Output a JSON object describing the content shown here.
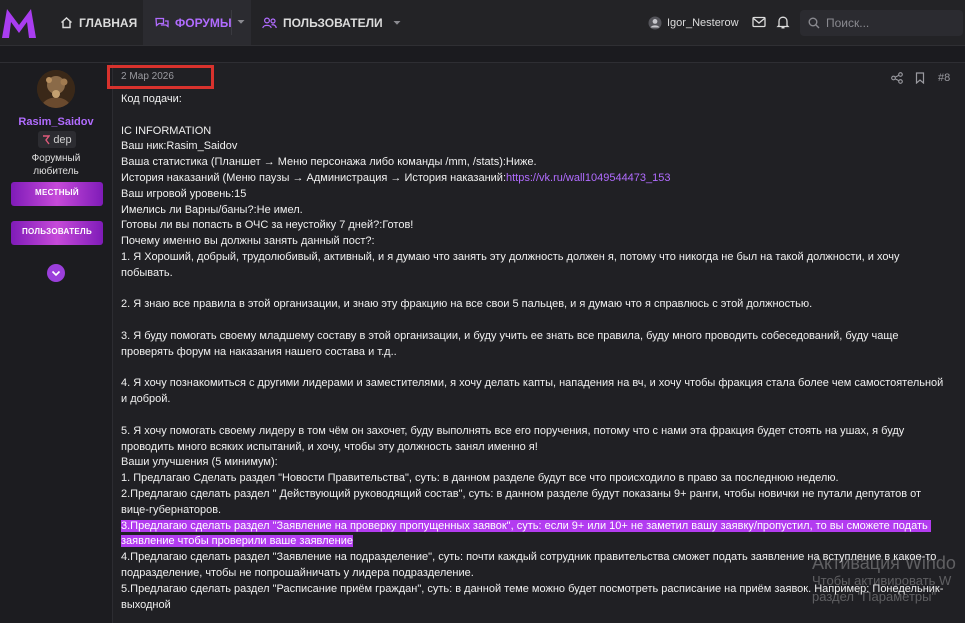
{
  "nav": {
    "home": "ГЛАВНАЯ",
    "forums": "ФОРУМЫ",
    "users": "ПОЛЬЗОВАТЕЛИ",
    "username": "Igor_Nesterow",
    "search_placeholder": "Поиск..."
  },
  "author": {
    "name": "Rasim_Saidov",
    "badge": "dep",
    "title_line1": "Форумный",
    "title_line2": "любитель",
    "banner1": "МЕСТНЫЙ",
    "banner2": "ПОЛЬЗОВАТЕЛЬ"
  },
  "post": {
    "date": "2 Мар 2026",
    "number": "#8",
    "link": "https://vk.ru/wall1049544473_153",
    "lines": [
      "Код подачи:",
      "",
      "IC INFORMATION",
      "Ваш ник:Rasim_Saidov",
      "Ваша статистика (Планшет → Меню персонажа либо команды /mm, /stats):Ниже.",
      "История наказаний (Меню паузы → Администрация → История наказаний:",
      "Ваш игровой уровень:15",
      "Имелись ли Варны/баны?:Не имел.",
      "Готовы ли вы попасть в ОЧС за неустойку 7 дней?:Готов!",
      "Почему именно вы должны занять данный пост?:",
      "1. Я Хороший, добрый, трудолюбивый, активный, и я думаю что занять эту должность должен я, потому что никогда не был на такой должности, и хочу побывать.",
      "",
      "2. Я знаю все правила в этой организации, и знаю эту фракцию на все свои 5 пальцев, и я думаю что я справлюсь с этой должностью.",
      "",
      "3. Я буду помогать своему младшему составу в этой организации, и буду учить ее знать все правила, буду много проводить собеседований, буду чаще проверять форум на наказания нашего состава и т.д..",
      "",
      "4. Я хочу познакомиться с другими лидерами и заместителями, я хочу делать капты, нападения на вч, и хочу чтобы фракция стала более чем самостоятельной и доброй.",
      "",
      "5. Я хочу помогать своему лидеру в том чём он захочет, буду выполнять все его поручения, потому что с нами эта фракция будет стоять на ушах, я буду проводить много всяких испытаний, и хочу, чтобы эту должность занял именно я!",
      "Ваши улучшения (5 минимум):",
      "1. Предлагаю Сделать раздел \"Новости Правительства\", суть: в данном разделе будут все что происходило в право за последнюю неделю.",
      "2.Предлагаю сделать раздел \" Действующий руководящий состав\", суть: в данном разделе будут показаны 9+ ранги, чтобы новички не путали депутатов от вице-губернаторов.",
      "3.Предлагаю сделать раздел \"Заявление на проверку пропущенных заявок\", суть: если 9+ или 10+ не заметил вашу заявку/пропустил, то вы сможете подать заявление чтобы проверили ваше заявление",
      "4.Предлагаю сделать раздел \"Заявление на подразделение\", суть: почти каждый сотрудник правительства сможет подать заявление на вступление в какое-то подразделение, чтобы не попрошайничать у лидера подразделение.",
      "5.Предлагаю сделать раздел \"Расписание приём граждан\", суть: в данной теме можно будет посмотреть расписание на приём заявок. Например: Понедельник-выходной"
    ]
  },
  "watermark": {
    "line1": "Активация Windo",
    "line2": "Чтобы активировать W",
    "line3": "раздел \"Параметры\""
  },
  "colors": {
    "accent": "#b16cff",
    "highlight": "#b33cf0",
    "bg": "#1b1b1f"
  }
}
